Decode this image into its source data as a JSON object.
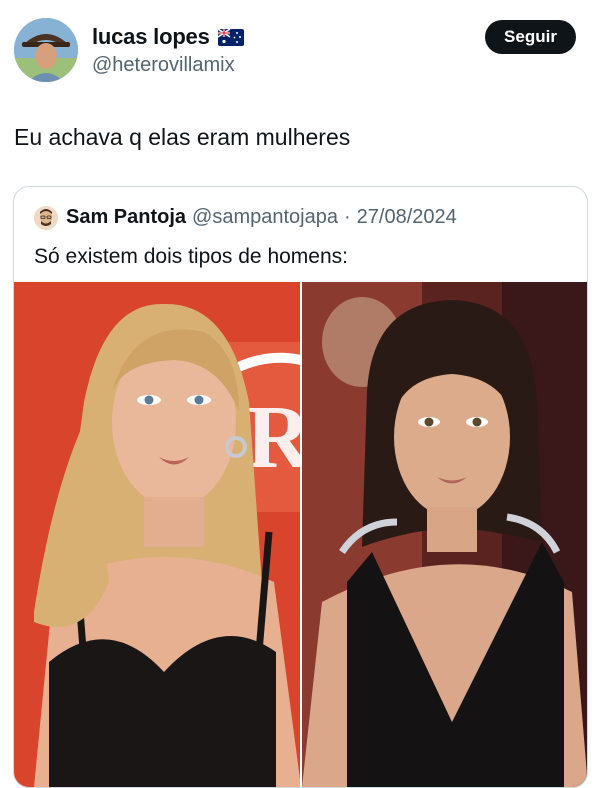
{
  "tweet": {
    "author_name": "lucas lopes",
    "author_handle": "@heterovillamix",
    "flag_icon": "australia-flag-icon",
    "follow_label": "Seguir",
    "text": "Eu achava q elas eram mulheres"
  },
  "quoted": {
    "author_name": "Sam Pantoja",
    "author_handle": "@sampantojapa",
    "separator": "·",
    "date": "27/08/2024",
    "text": "Só existem dois tipos de homens:",
    "images": [
      {
        "description_icon": "photo-blonde-woman"
      },
      {
        "description_icon": "photo-brunette-woman"
      }
    ]
  },
  "colors": {
    "text": "#0f1419",
    "secondary": "#536471",
    "border": "#cfd9de",
    "button_bg": "#0f1419",
    "left_photo_bg": "#d8442c",
    "right_photo_bg": "#7a2a24"
  }
}
